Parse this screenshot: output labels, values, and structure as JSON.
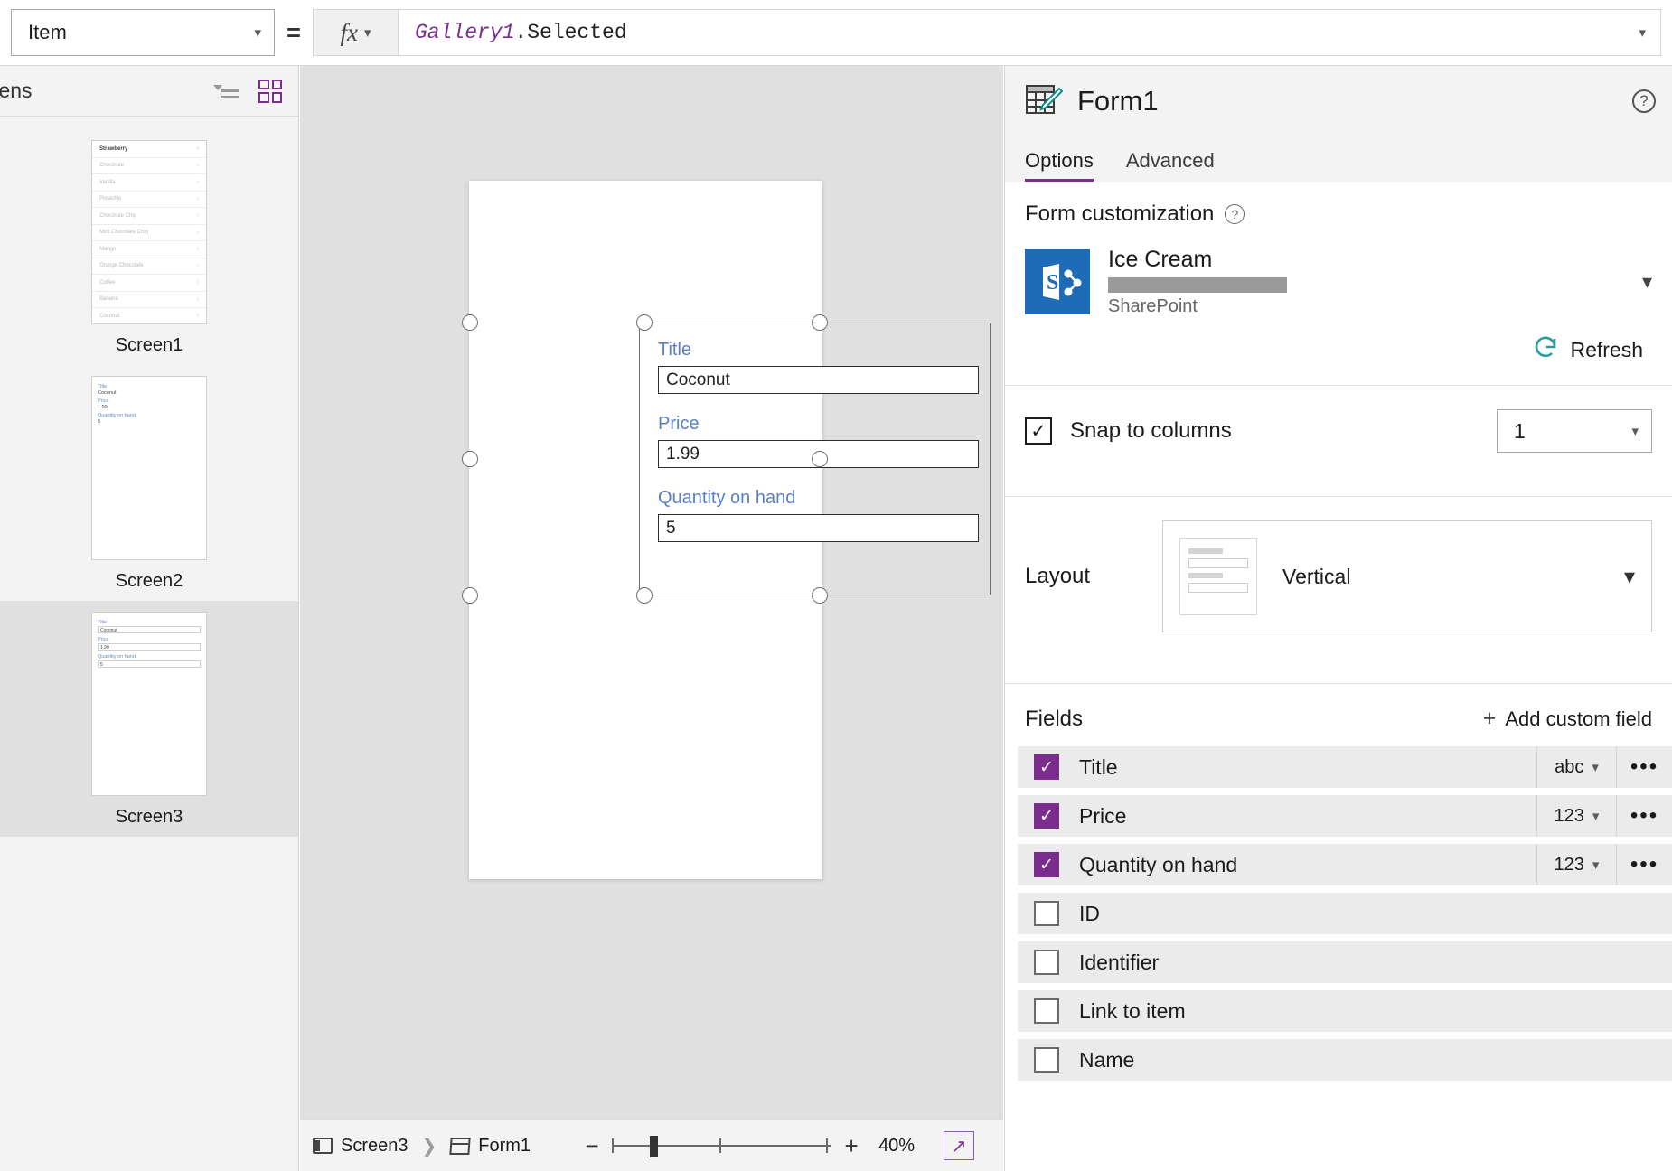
{
  "formula_bar": {
    "property": "Item",
    "equals": "=",
    "fx_label": "fx",
    "formula_object": "Gallery1",
    "formula_rest": ".Selected"
  },
  "left_panel": {
    "title": "reens",
    "icons": {
      "tree": "tree-view-icon",
      "grid": "grid-view-icon"
    },
    "screens": [
      {
        "label": "Screen1",
        "type": "gallery",
        "items": [
          "Strawberry",
          "Chocolate",
          "Vanilla",
          "Pistachio",
          "Chocolate Chip",
          "Mint Chocolate Chip",
          "Mango",
          "Orange Chocolate",
          "Coffee",
          "Banana",
          "Coconut"
        ],
        "selected": false
      },
      {
        "label": "Screen2",
        "type": "form",
        "fields": [
          {
            "label": "Title",
            "value": "Coconut"
          },
          {
            "label": "Price",
            "value": "1.99"
          },
          {
            "label": "Quantity on hand",
            "value": "5"
          }
        ],
        "selected": false
      },
      {
        "label": "Screen3",
        "type": "form-boxed",
        "fields": [
          {
            "label": "Title",
            "value": "Coconut"
          },
          {
            "label": "Price",
            "value": "1.99"
          },
          {
            "label": "Quantity on hand",
            "value": "5"
          }
        ],
        "selected": true
      }
    ]
  },
  "canvas": {
    "form_fields": [
      {
        "label": "Title",
        "value": "Coconut"
      },
      {
        "label": "Price",
        "value": "1.99"
      },
      {
        "label": "Quantity on hand",
        "value": "5"
      }
    ]
  },
  "status_bar": {
    "breadcrumb": [
      {
        "label": "Screen3",
        "icon": "screen-icon"
      },
      {
        "label": "Form1",
        "icon": "form-icon"
      }
    ],
    "zoom_out": "−",
    "zoom_in": "+",
    "zoom_level": "40%",
    "fit_icon": "fit-to-screen-icon"
  },
  "right_panel": {
    "title": "Form1",
    "help_icon": "?",
    "tabs": [
      {
        "label": "Options",
        "active": true
      },
      {
        "label": "Advanced",
        "active": false
      }
    ],
    "form_customization": {
      "title": "Form customization",
      "help": "?",
      "data_source": {
        "name": "Ice Cream",
        "url_redacted": "",
        "type": "SharePoint",
        "icon": "sharepoint-icon",
        "chevron": "⌄"
      },
      "refresh_label": "Refresh",
      "refresh_icon": "refresh-icon"
    },
    "snap_to_columns": {
      "label": "Snap to columns",
      "checked": true,
      "check_glyph": "✓",
      "columns": "1"
    },
    "layout": {
      "label": "Layout",
      "value": "Vertical",
      "chevron": "⌄"
    },
    "fields": {
      "title": "Fields",
      "add_label": "Add custom field",
      "add_plus": "+",
      "rows": [
        {
          "name": "Title",
          "checked": true,
          "type": "abc",
          "menu": "•••"
        },
        {
          "name": "Price",
          "checked": true,
          "type": "123",
          "menu": "•••"
        },
        {
          "name": "Quantity on hand",
          "checked": true,
          "type": "123",
          "menu": "•••"
        },
        {
          "name": "ID",
          "checked": false,
          "type": "",
          "menu": ""
        },
        {
          "name": "Identifier",
          "checked": false,
          "type": "",
          "menu": ""
        },
        {
          "name": "Link to item",
          "checked": false,
          "type": "",
          "menu": ""
        },
        {
          "name": "Name",
          "checked": false,
          "type": "",
          "menu": ""
        }
      ]
    }
  }
}
